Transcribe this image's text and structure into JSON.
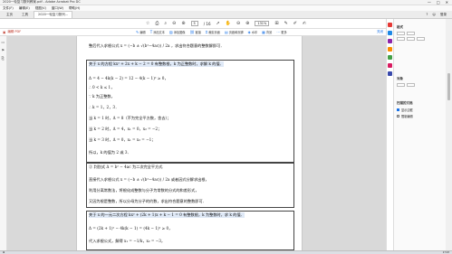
{
  "window": {
    "title": "2020一轮复习数列教案.pdf - Adobe Acrobat Pro DC",
    "controls": [
      "—",
      "□",
      "✕"
    ]
  },
  "menu": [
    "文件(F)",
    "编辑(E)",
    "视图(V)",
    "窗口(W)",
    "帮助(H)"
  ],
  "tabs": [
    {
      "label": "主页"
    },
    {
      "label": "工具"
    },
    {
      "label": "2020一轮复习数列..."
    }
  ],
  "tabbar_right": [
    "?",
    "☺",
    "登录"
  ],
  "nav": {
    "page_current": "5",
    "page_total": "/ 16",
    "zoom": "131%",
    "share_icon": "share-icon"
  },
  "edit_label": "编辑 PDF",
  "edit_tools": [
    "编辑",
    "添加文本",
    "添加图像",
    "链接",
    "裁剪页面",
    "页眉和页脚",
    "水印",
    "背景",
    "更多"
  ],
  "edit_close": "关闭",
  "page_lines": [
    "整后代入求根公式 x = (−b ± √(b²−4ac)) / 2a ，求出符合题意的整数解即可．",
    "关于 x 的方程 kx² + 2x + k − 2 = 0 有整数根，k 为正整数时，求解 k 的值．",
    "Δ = 4 − 4k(k − 2) = 12 − 4(k − 1)² ≥ 0，",
    "∴ 0 < k ≤ 1，",
    "∵ k 为正整数，",
    "∴ k = 1，2，3．",
    "当 k = 1 时，Δ = 8（不为完全平方数，舍去）；",
    "当 k = 2 时，Δ = 4，x₁ = 0，x₂ = −2；",
    "当 k = 3 时，Δ = 0，x₁ = x₂ = −1；",
    "所以，k 的值为 2 或 3．",
    "② 判别式 Δ = b² − 4ac 为二次完全平方式",
    "直接代入求根公式 x = (−b ± √(b²−4ac)) / 2a 或者因式分解求出根，",
    "利用分离常数法，将根化成整数与分子为常数的分式的和差形式，",
    "又因为根是整数，所以分母为分子的约数，求出符合题意的整数即可．",
    "关于 x 的一元二次方程 kx² + (2k + 1)x + k − 1 = 0 有整数根，k 为整数时，求 k 的值．",
    "Δ = (2k + 1)² − 4k(k − 1) = (4k − 1)² ≥ 0，",
    "代入求根公式，解得 x₁ = −1/k，x₂ = −3，"
  ],
  "panel": {
    "title": "格式",
    "section2": "对象",
    "section3": "扫描的文档",
    "checks": [
      {
        "label": "显示边框",
        "on": true
      },
      {
        "label": "限制编辑",
        "on": false
      }
    ]
  },
  "taskbar": {
    "clock": "17:03"
  }
}
